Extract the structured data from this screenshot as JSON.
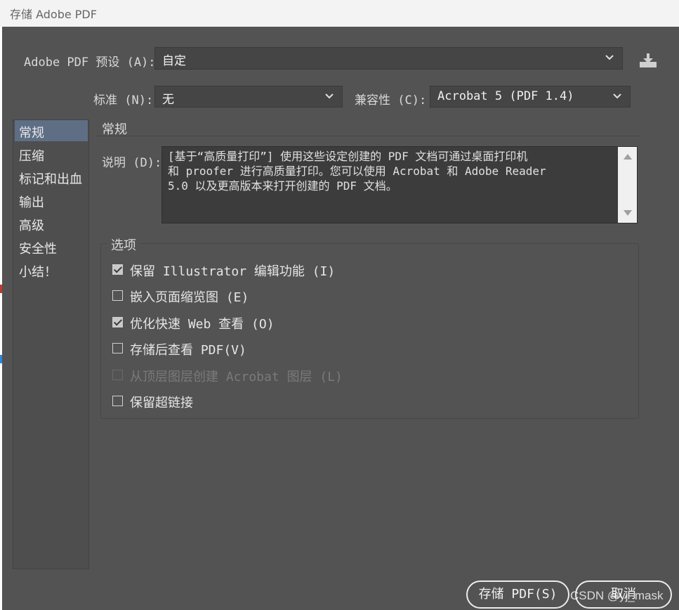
{
  "window": {
    "title": "存储 Adobe PDF"
  },
  "preset": {
    "label": "Adobe PDF 预设 (A):",
    "value": "自定",
    "save_icon": "save-preset-icon"
  },
  "standard": {
    "label": "标准 (N):",
    "value": "无"
  },
  "compatibility": {
    "label": "兼容性 (C):",
    "value": "Acrobat 5 (PDF 1.4)"
  },
  "sidebar": {
    "items": [
      {
        "label": "常规",
        "active": true
      },
      {
        "label": "压缩"
      },
      {
        "label": "标记和出血"
      },
      {
        "label": "输出"
      },
      {
        "label": "高级"
      },
      {
        "label": "安全性"
      },
      {
        "label": "小结！"
      }
    ]
  },
  "general": {
    "heading": "常规",
    "description_label": "说明 (D):",
    "description_lines": [
      "[基于“高质量打印”] 使用这些设定创建的 PDF 文档可通过桌面打印机",
      "和 proofer 进行高质量打印。您可以使用 Acrobat 和 Adobe Reader",
      "5.0 以及更高版本来打开创建的 PDF 文档。"
    ]
  },
  "options": {
    "title": "选项",
    "items": [
      {
        "label": "保留 Illustrator 编辑功能 (I)",
        "checked": true,
        "disabled": false
      },
      {
        "label": "嵌入页面缩览图 (E)",
        "checked": false,
        "disabled": false
      },
      {
        "label": "优化快速 Web 查看 (O)",
        "checked": true,
        "disabled": false
      },
      {
        "label": "存储后查看 PDF(V)",
        "checked": false,
        "disabled": false
      },
      {
        "label": "从顶层图层创建 Acrobat 图层 (L)",
        "checked": false,
        "disabled": true
      },
      {
        "label": "保留超链接",
        "checked": false,
        "disabled": false
      }
    ]
  },
  "buttons": {
    "save": "存储 PDF(S)",
    "cancel": "取消"
  },
  "watermark": "CSDN @yj_mask",
  "colors": {
    "dialog_bg": "#535353",
    "active_item": "#5e6e85"
  }
}
